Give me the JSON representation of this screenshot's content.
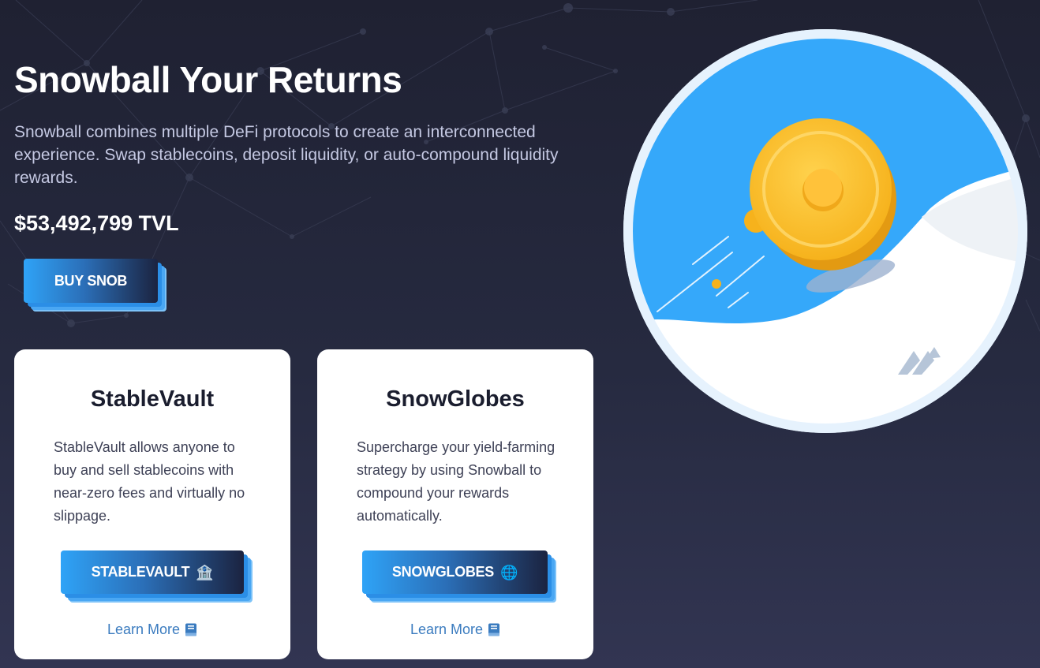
{
  "hero": {
    "title": "Snowball Your Returns",
    "description": "Snowball combines multiple DeFi protocols to create an interconnected experience. Swap stablecoins, deposit liquidity, or auto-compound liquidity rewards.",
    "tvl": "$53,492,799 TVL",
    "buy_button": "BUY SNOB"
  },
  "cards": [
    {
      "title": "StableVault",
      "description": "StableVault allows anyone to buy and sell stablecoins with near-zero fees and virtually no slippage.",
      "button_label": "STABLEVAULT",
      "button_emoji": "🏦",
      "learn_more": "Learn More",
      "learn_more_icon": "book-icon"
    },
    {
      "title": "SnowGlobes",
      "description": "Supercharge your yield-farming strategy by using Snowball to compound your rewards automatically.",
      "button_label": "SNOWGLOBES",
      "button_emoji": "🌐",
      "learn_more": "Learn More",
      "learn_more_icon": "book-icon"
    }
  ],
  "colors": {
    "background_dark": "#1f2132",
    "accent_blue": "#2fa3f7",
    "link_blue": "#3a7bbf",
    "card_bg": "#ffffff"
  }
}
